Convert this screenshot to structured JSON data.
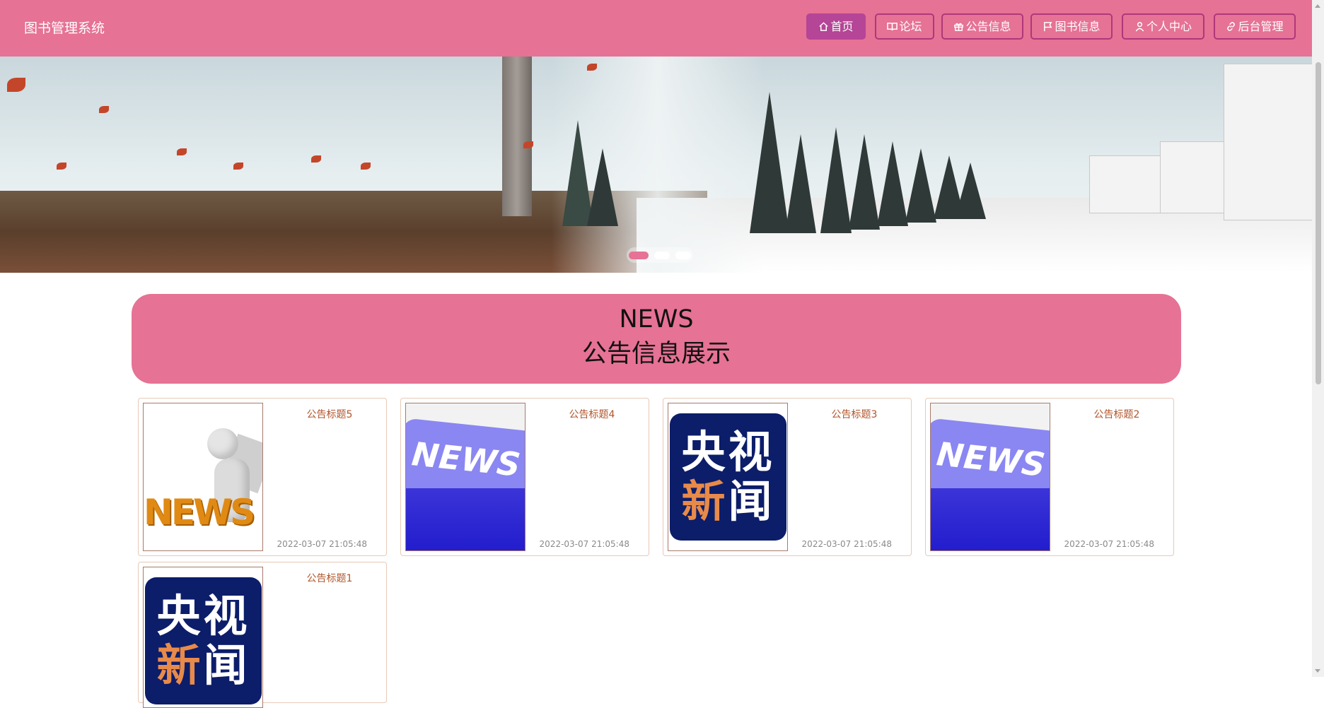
{
  "header": {
    "brand": "图书管理系统",
    "nav": [
      {
        "label": "首页",
        "icon": "home-icon",
        "active": true
      },
      {
        "label": "论坛",
        "icon": "book-open-icon",
        "active": false
      },
      {
        "label": "公告信息",
        "icon": "gift-icon",
        "active": false
      },
      {
        "label": "图书信息",
        "icon": "flag-icon",
        "active": false
      },
      {
        "label": "个人中心",
        "icon": "user-icon",
        "active": false
      },
      {
        "label": "后台管理",
        "icon": "link-icon",
        "active": false
      }
    ]
  },
  "banner": {
    "slides": 3,
    "active_slide": 1
  },
  "news": {
    "heading_en": "NEWS",
    "heading_zh": "公告信息展示",
    "items": [
      {
        "title": "公告标题5",
        "date": "2022-03-07 21:05:48",
        "image": "news-figure"
      },
      {
        "title": "公告标题4",
        "date": "2022-03-07 21:05:48",
        "image": "news-sign"
      },
      {
        "title": "公告标题3",
        "date": "2022-03-07 21:05:48",
        "image": "cctv-news"
      },
      {
        "title": "公告标题2",
        "date": "2022-03-07 21:05:48",
        "image": "news-sign"
      },
      {
        "title": "公告标题1",
        "date": "",
        "image": "cctv-news"
      }
    ]
  },
  "colors": {
    "accent": "#e67295",
    "nav_active": "#b54596",
    "title_text": "#b0552a"
  }
}
